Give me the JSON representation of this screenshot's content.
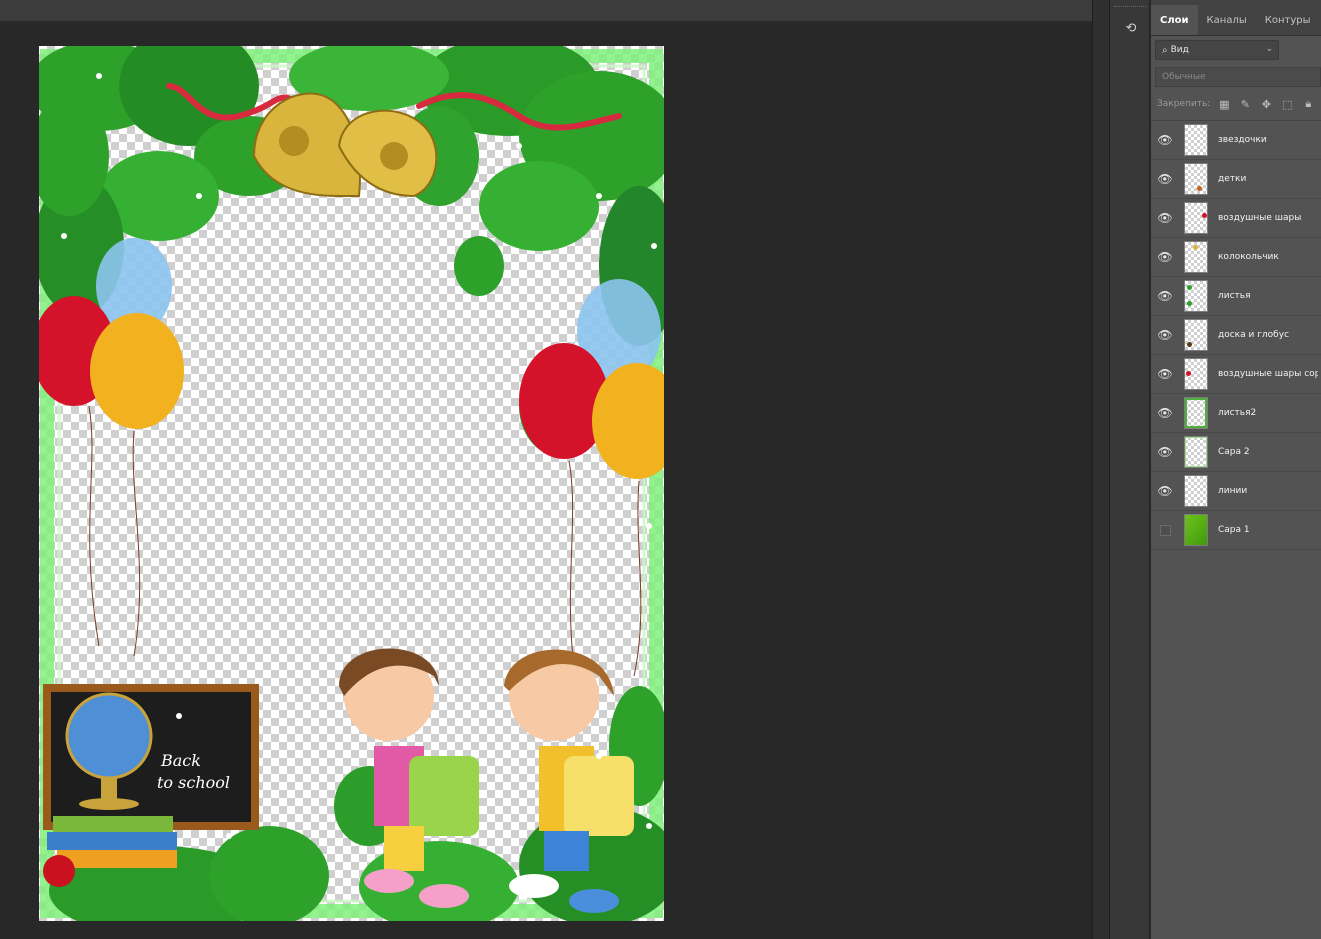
{
  "panel": {
    "tabs": [
      {
        "label": "Слои",
        "active": true
      },
      {
        "label": "Каналы",
        "active": false
      },
      {
        "label": "Контуры",
        "active": false
      }
    ],
    "filter_label": "Вид",
    "blend_mode": "Обычные",
    "lock_label": "Закрепить:",
    "layers": [
      {
        "name": "звездочки",
        "visible": true,
        "thumb": "transparent"
      },
      {
        "name": "детки",
        "visible": true,
        "thumb": "transparent"
      },
      {
        "name": "воздушные шары",
        "visible": true,
        "thumb": "transparent"
      },
      {
        "name": "колокольчик",
        "visible": true,
        "thumb": "transparent"
      },
      {
        "name": "листья",
        "visible": true,
        "thumb": "transparent"
      },
      {
        "name": "доска и глобус",
        "visible": true,
        "thumb": "transparent"
      },
      {
        "name": "воздушные шары copy",
        "visible": true,
        "thumb": "transparent"
      },
      {
        "name": "листья2",
        "visible": true,
        "thumb": "transparent"
      },
      {
        "name": "Сара 2",
        "visible": true,
        "thumb": "transparent"
      },
      {
        "name": "линии",
        "visible": true,
        "thumb": "transparent"
      },
      {
        "name": "Сара 1",
        "visible": false,
        "thumb": "green"
      }
    ]
  },
  "canvas": {
    "chalkboard_text_line1": "Back",
    "chalkboard_text_line2": "to school"
  },
  "colors": {
    "leaf": "#2e9e2a",
    "leaf_dark": "#1c7a1f",
    "frame_green": "#6de86a",
    "bell": "#d6b23a",
    "balloon_red": "#d4132a",
    "balloon_yellow": "#f2b11e",
    "balloon_blue": "#8cc4ef"
  }
}
